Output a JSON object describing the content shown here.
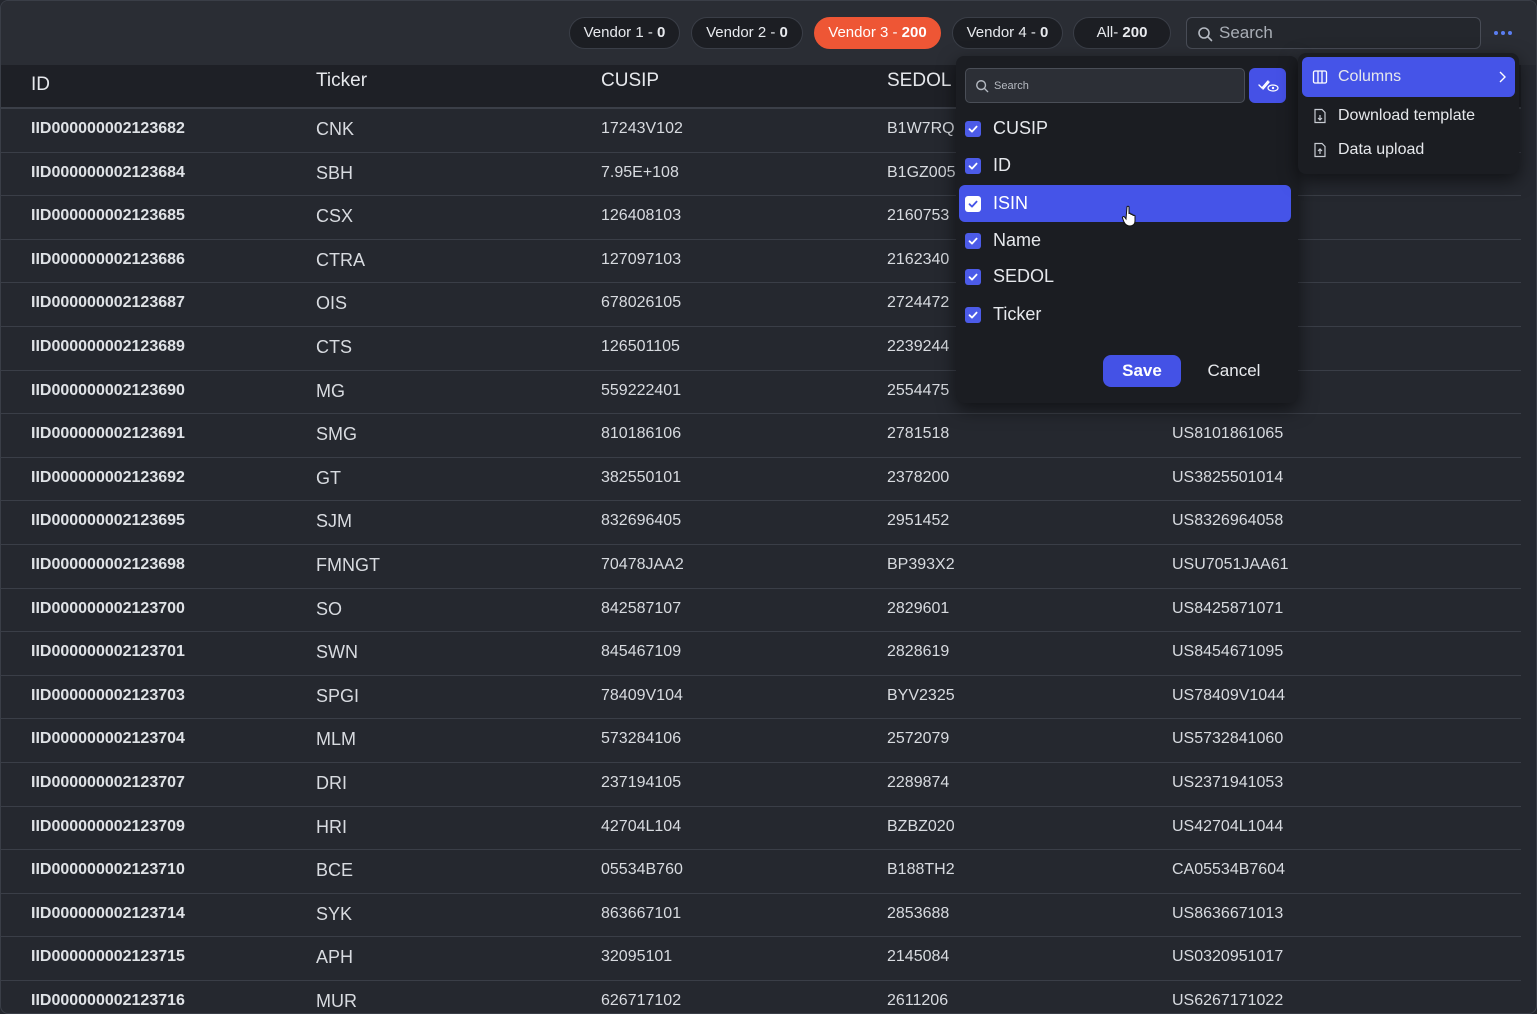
{
  "filters": [
    {
      "label": "Vendor 1 - ",
      "count": "0",
      "active": false
    },
    {
      "label": "Vendor 2 - ",
      "count": "0",
      "active": false
    },
    {
      "label": "Vendor 3 - ",
      "count": "200",
      "active": true
    },
    {
      "label": "Vendor 4 - ",
      "count": "0",
      "active": false
    },
    {
      "label": "All- ",
      "count": "200",
      "active": false
    }
  ],
  "search": {
    "placeholder": "Search"
  },
  "table": {
    "headers": [
      "ID",
      "Ticker",
      "CUSIP",
      "SEDOL"
    ],
    "rows": [
      [
        "IID000000002123682",
        "CNK",
        "17243V102",
        "B1W7RQ",
        ""
      ],
      [
        "IID000000002123684",
        "SBH",
        "7.95E+108",
        "B1GZ005",
        ""
      ],
      [
        "IID000000002123685",
        "CSX",
        "126408103",
        "2160753",
        ""
      ],
      [
        "IID000000002123686",
        "CTRA",
        "127097103",
        "2162340",
        ""
      ],
      [
        "IID000000002123687",
        "OIS",
        "678026105",
        "2724472",
        ""
      ],
      [
        "IID000000002123689",
        "CTS",
        "126501105",
        "2239244",
        ""
      ],
      [
        "IID000000002123690",
        "MG",
        "559222401",
        "2554475",
        ""
      ],
      [
        "IID000000002123691",
        "SMG",
        "810186106",
        "2781518",
        "US8101861065"
      ],
      [
        "IID000000002123692",
        "GT",
        "382550101",
        "2378200",
        "US3825501014"
      ],
      [
        "IID000000002123695",
        "SJM",
        "832696405",
        "2951452",
        "US8326964058"
      ],
      [
        "IID000000002123698",
        "FMNGT",
        "70478JAA2",
        "BP393X2",
        "USU7051JAA61"
      ],
      [
        "IID000000002123700",
        "SO",
        "842587107",
        "2829601",
        "US8425871071"
      ],
      [
        "IID000000002123701",
        "SWN",
        "845467109",
        "2828619",
        "US8454671095"
      ],
      [
        "IID000000002123703",
        "SPGI",
        "78409V104",
        "BYV2325",
        "US78409V1044"
      ],
      [
        "IID000000002123704",
        "MLM",
        "573284106",
        "2572079",
        "US5732841060"
      ],
      [
        "IID000000002123707",
        "DRI",
        "237194105",
        "2289874",
        "US2371941053"
      ],
      [
        "IID000000002123709",
        "HRI",
        "42704L104",
        "BZBZ020",
        "US42704L1044"
      ],
      [
        "IID000000002123710",
        "BCE",
        "05534B760",
        "B188TH2",
        "CA05534B7604"
      ],
      [
        "IID000000002123714",
        "SYK",
        "863667101",
        "2853688",
        "US8636671013"
      ],
      [
        "IID000000002123715",
        "APH",
        "32095101",
        "2145084",
        "US0320951017"
      ],
      [
        "IID000000002123716",
        "MUR",
        "626717102",
        "2611206",
        "US6267171022"
      ]
    ]
  },
  "column_panel": {
    "search_placeholder": "Search",
    "items": [
      {
        "label": "CUSIP",
        "checked": true,
        "selected": false
      },
      {
        "label": "ID",
        "checked": true,
        "selected": false
      },
      {
        "label": "ISIN",
        "checked": true,
        "selected": true
      },
      {
        "label": "Name",
        "checked": true,
        "selected": false
      },
      {
        "label": "SEDOL",
        "checked": true,
        "selected": false
      },
      {
        "label": "Ticker",
        "checked": true,
        "selected": false
      }
    ],
    "save_label": "Save",
    "cancel_label": "Cancel"
  },
  "context_menu": {
    "items": [
      {
        "label": "Columns",
        "icon": "columns-icon",
        "active": true,
        "submenu": true
      },
      {
        "label": "Download template",
        "icon": "download-file-icon",
        "active": false,
        "submenu": false
      },
      {
        "label": "Data upload",
        "icon": "upload-file-icon",
        "active": false,
        "submenu": false
      }
    ]
  },
  "colors": {
    "accent": "#4554e8",
    "active_filter": "#ee5635",
    "background": "#25282f"
  }
}
